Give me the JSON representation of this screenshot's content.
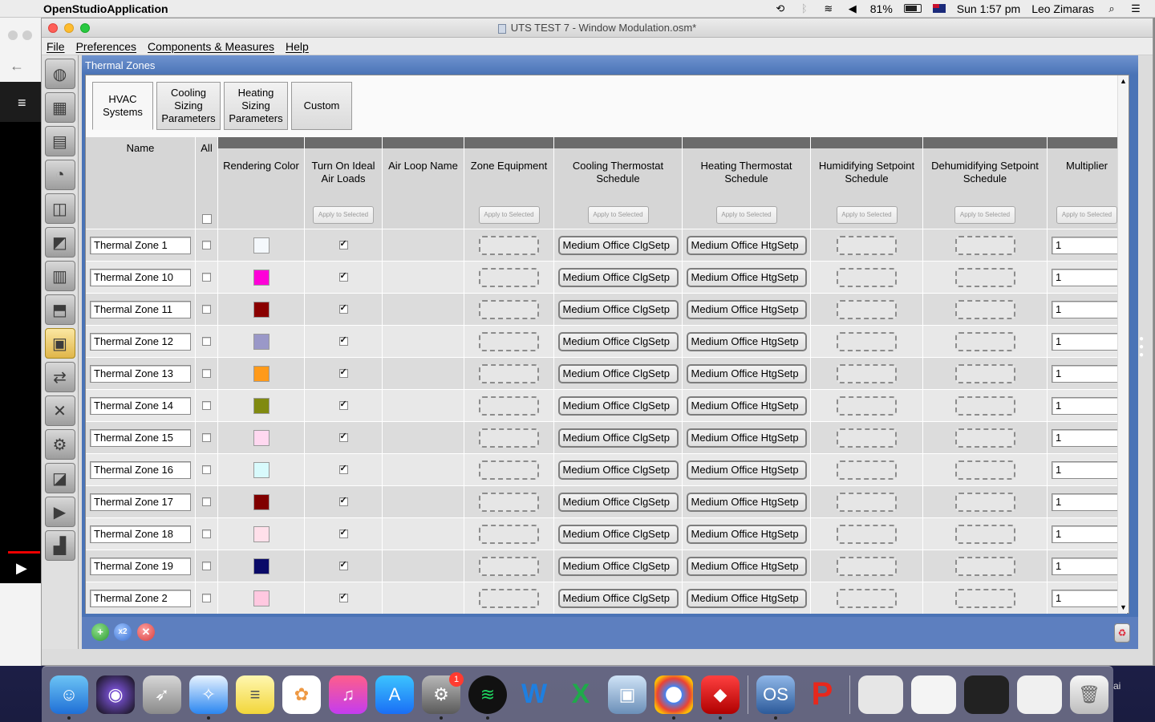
{
  "menubar": {
    "app_name": "OpenStudioApplication",
    "battery": "81%",
    "clock": "Sun 1:57 pm",
    "user": "Leo Zimaras",
    "battery_level": 0.81
  },
  "window": {
    "title": "UTS TEST 7 - Window Modulation.osm*",
    "menu": [
      "File",
      "Preferences",
      "Components & Measures",
      "Help"
    ]
  },
  "panel": {
    "title": "Thermal Zones",
    "subtabs": [
      "HVAC Systems",
      "Cooling Sizing Parameters",
      "Heating Sizing Parameters",
      "Custom"
    ]
  },
  "table": {
    "headers": {
      "name": "Name",
      "all": "All",
      "color": "Rendering Color",
      "ideal": "Turn On Ideal Air Loads",
      "airloop": "Air Loop Name",
      "equipment": "Zone Equipment",
      "cooling": "Cooling Thermostat Schedule",
      "heating": "Heating Thermostat Schedule",
      "humid": "Humidifying Setpoint Schedule",
      "dehumid": "Dehumidifying Setpoint Schedule",
      "multiplier": "Multiplier"
    },
    "apply_label": "Apply to Selected",
    "rows": [
      {
        "name": "Thermal Zone 1",
        "color": "#f4f8fc",
        "ideal": true,
        "cooling": "Medium Office ClgSetp",
        "heating": "Medium Office HtgSetp",
        "multiplier": "1"
      },
      {
        "name": "Thermal Zone 10",
        "color": "#ff00d8",
        "ideal": true,
        "cooling": "Medium Office ClgSetp",
        "heating": "Medium Office HtgSetp",
        "multiplier": "1"
      },
      {
        "name": "Thermal Zone 11",
        "color": "#8a0000",
        "ideal": true,
        "cooling": "Medium Office ClgSetp",
        "heating": "Medium Office HtgSetp",
        "multiplier": "1"
      },
      {
        "name": "Thermal Zone 12",
        "color": "#9a98c8",
        "ideal": true,
        "cooling": "Medium Office ClgSetp",
        "heating": "Medium Office HtgSetp",
        "multiplier": "1"
      },
      {
        "name": "Thermal Zone 13",
        "color": "#ff9a1a",
        "ideal": true,
        "cooling": "Medium Office ClgSetp",
        "heating": "Medium Office HtgSetp",
        "multiplier": "1"
      },
      {
        "name": "Thermal Zone 14",
        "color": "#808a10",
        "ideal": true,
        "cooling": "Medium Office ClgSetp",
        "heating": "Medium Office HtgSetp",
        "multiplier": "1"
      },
      {
        "name": "Thermal Zone 15",
        "color": "#ffd8f0",
        "ideal": true,
        "cooling": "Medium Office ClgSetp",
        "heating": "Medium Office HtgSetp",
        "multiplier": "1"
      },
      {
        "name": "Thermal Zone 16",
        "color": "#d8fafc",
        "ideal": true,
        "cooling": "Medium Office ClgSetp",
        "heating": "Medium Office HtgSetp",
        "multiplier": "1"
      },
      {
        "name": "Thermal Zone 17",
        "color": "#800000",
        "ideal": true,
        "cooling": "Medium Office ClgSetp",
        "heating": "Medium Office HtgSetp",
        "multiplier": "1"
      },
      {
        "name": "Thermal Zone 18",
        "color": "#ffe0ea",
        "ideal": true,
        "cooling": "Medium Office ClgSetp",
        "heating": "Medium Office HtgSetp",
        "multiplier": "1"
      },
      {
        "name": "Thermal Zone 19",
        "color": "#0a0a68",
        "ideal": true,
        "cooling": "Medium Office ClgSetp",
        "heating": "Medium Office HtgSetp",
        "multiplier": "1"
      },
      {
        "name": "Thermal Zone 2",
        "color": "#ffc8e0",
        "ideal": true,
        "cooling": "Medium Office ClgSetp",
        "heating": "Medium Office HtgSetp",
        "multiplier": "1"
      }
    ]
  },
  "dock": {
    "system_preferences_badge": "1"
  },
  "side_text": "ai"
}
